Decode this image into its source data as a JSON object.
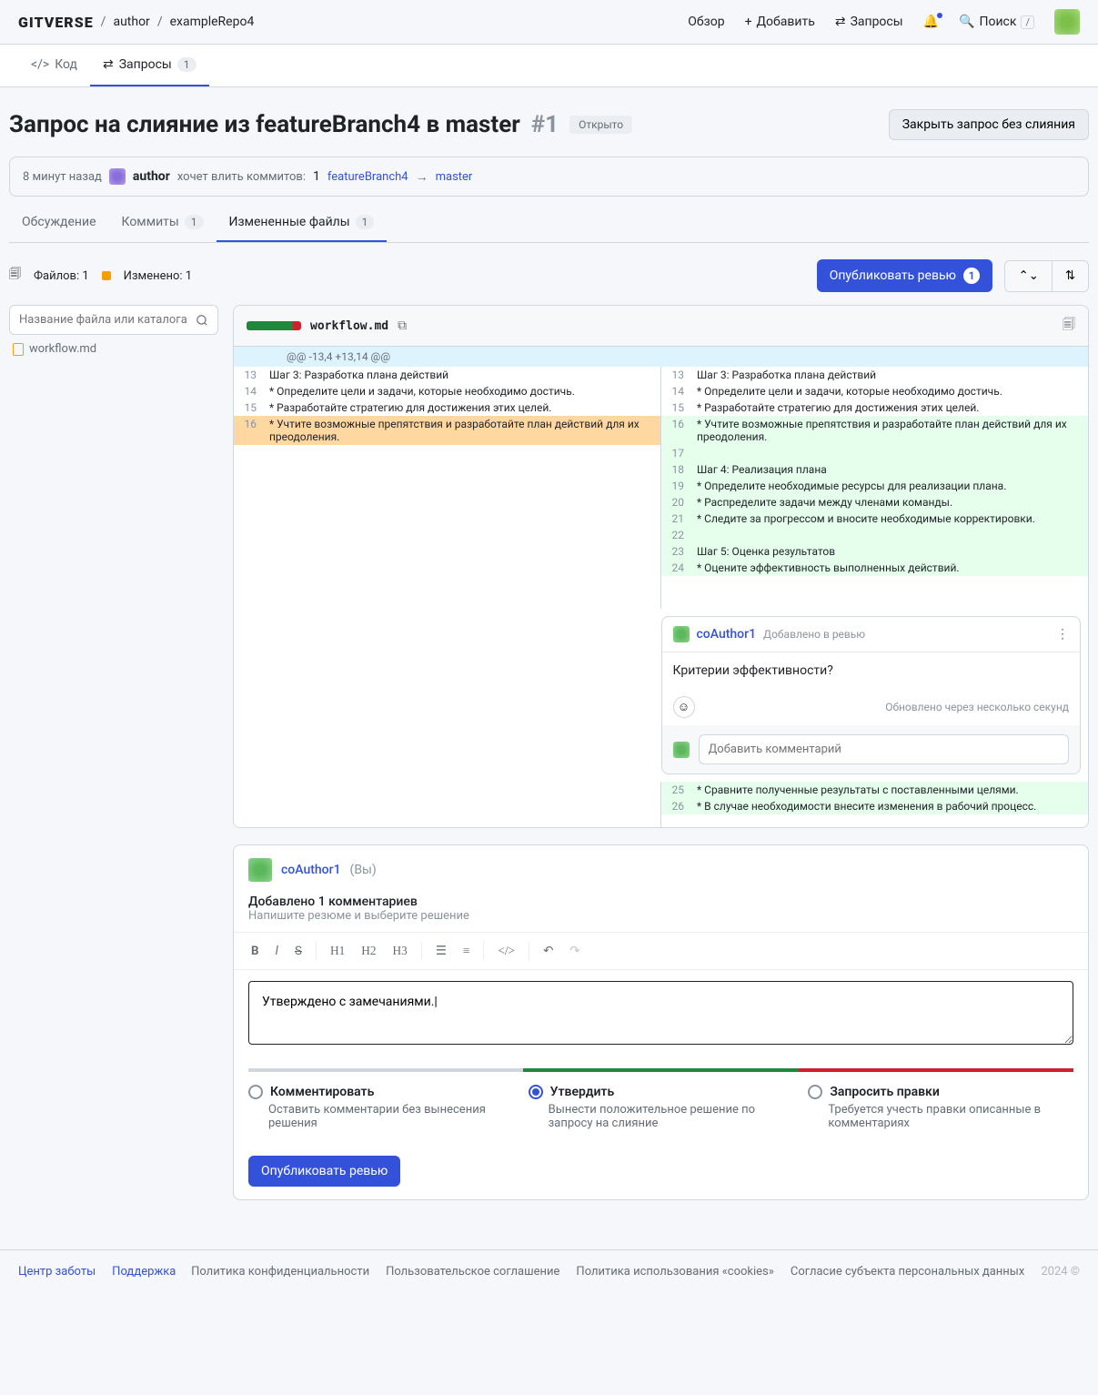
{
  "header": {
    "logo": "GITVERSE",
    "crumb_author": "author",
    "crumb_repo": "exampleRepo4",
    "overview": "Обзор",
    "add": "Добавить",
    "requests": "Запросы",
    "search": "Поиск"
  },
  "nav": {
    "code": "Код",
    "requests": "Запросы",
    "requests_count": "1"
  },
  "pr": {
    "title": "Запрос на слияние из featureBranch4 в master",
    "number": "#1",
    "status": "Открыто",
    "close_btn": "Закрыть запрос без слияния",
    "time_ago": "8 минут назад",
    "author": "author",
    "wants": "хочет влить коммитов:",
    "commits_count": "1",
    "from_branch": "featureBranch4",
    "to_branch": "master"
  },
  "subtabs": {
    "discussion": "Обсуждение",
    "commits": "Коммиты",
    "commits_count": "1",
    "files": "Измененные файлы",
    "files_count": "1"
  },
  "filebar": {
    "files_label": "Файлов:",
    "files_n": "1",
    "changed_label": "Изменено:",
    "changed_n": "1",
    "publish": "Опубликовать ревью",
    "publish_count": "1",
    "search_placeholder": "Название файла или каталога",
    "tree_file": "workflow.md"
  },
  "diff": {
    "file": "workflow.md",
    "hunk": "@@ -13,4 +13,14 @@",
    "left": [
      {
        "n": "13",
        "t": "Шаг 3: Разработка плана действий",
        "c": "ctx"
      },
      {
        "n": "14",
        "t": "* Определите цели и задачи, которые необходимо достичь.",
        "c": "ctx"
      },
      {
        "n": "15",
        "t": "* Разработайте стратегию для достижения этих целей.",
        "c": "ctx"
      },
      {
        "n": "16",
        "t": "* Учтите возможные препятствия и разработайте план действий для их преодоления.",
        "c": "hl-del"
      }
    ],
    "right": [
      {
        "n": "13",
        "t": "Шаг 3: Разработка плана действий",
        "c": "ctx"
      },
      {
        "n": "14",
        "t": "* Определите цели и задачи, которые необходимо достичь.",
        "c": "ctx"
      },
      {
        "n": "15",
        "t": "* Разработайте стратегию для достижения этих целей.",
        "c": "ctx"
      },
      {
        "n": "16",
        "t": "* Учтите возможные препятствия и разработайте план действий для их преодоления.",
        "c": "add"
      },
      {
        "n": "17",
        "t": "",
        "c": "add"
      },
      {
        "n": "18",
        "t": "Шаг 4: Реализация плана",
        "c": "add"
      },
      {
        "n": "19",
        "t": "* Определите необходимые ресурсы для реализации плана.",
        "c": "add"
      },
      {
        "n": "20",
        "t": "* Распределите задачи между членами команды.",
        "c": "add"
      },
      {
        "n": "21",
        "t": "* Следите за прогрессом и вносите необходимые корректировки.",
        "c": "add"
      },
      {
        "n": "22",
        "t": "",
        "c": "add"
      },
      {
        "n": "23",
        "t": "Шаг 5: Оценка результатов",
        "c": "add"
      },
      {
        "n": "24",
        "t": "* Оцените эффективность выполненных действий.",
        "c": "add"
      }
    ],
    "right_after": [
      {
        "n": "25",
        "t": "* Сравните полученные результаты с поставленными целями.",
        "c": "add"
      },
      {
        "n": "26",
        "t": "* В случае необходимости внесите изменения в рабочий процесс.",
        "c": "add"
      }
    ]
  },
  "comment": {
    "author": "coAuthor1",
    "badge": "Добавлено в ревью",
    "body": "Критерии эффективности?",
    "updated": "Обновлено через несколько секунд",
    "reply_placeholder": "Добавить комментарий"
  },
  "review": {
    "author": "coAuthor1",
    "you": "(Вы)",
    "added": "Добавлено 1 комментариев",
    "hint": "Напишите резюме и выберите решение",
    "text": "Утверждено с замечаниями.|",
    "opt_comment": "Комментировать",
    "opt_comment_desc": "Оставить комментарии без вынесения решения",
    "opt_approve": "Утвердить",
    "opt_approve_desc": "Вынести положительное решение по запросу на слияние",
    "opt_changes": "Запросить правки",
    "opt_changes_desc": "Требуется учесть правки описанные в комментариях",
    "publish": "Опубликовать ревью"
  },
  "footer": {
    "care": "Центр заботы",
    "support": "Поддержка",
    "privacy": "Политика конфиденциальности",
    "terms": "Пользовательское соглашение",
    "cookies": "Политика использования «cookies»",
    "personal": "Согласие субъекта персональных данных",
    "year": "2024 ©"
  }
}
